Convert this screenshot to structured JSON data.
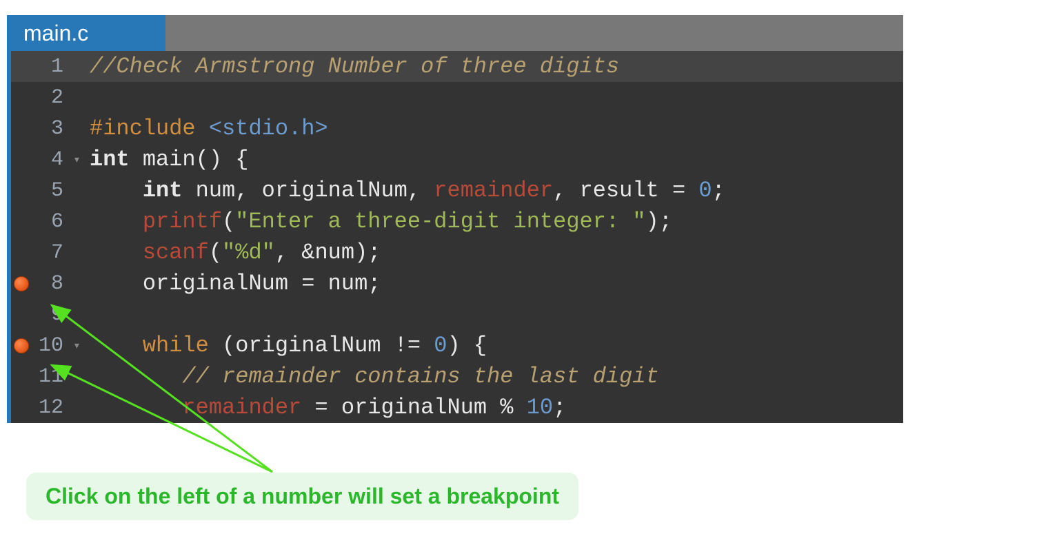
{
  "tab": {
    "filename": "main.c"
  },
  "annotation": {
    "text": "Click on the left of a number will set a breakpoint"
  },
  "lines": {
    "l1": {
      "num": "1"
    },
    "l2": {
      "num": "2"
    },
    "l3": {
      "num": "3"
    },
    "l4": {
      "num": "4"
    },
    "l5": {
      "num": "5"
    },
    "l6": {
      "num": "6"
    },
    "l7": {
      "num": "7"
    },
    "l8": {
      "num": "8"
    },
    "l9": {
      "num": "9"
    },
    "l10": {
      "num": "10"
    },
    "l11": {
      "num": "11"
    },
    "l12": {
      "num": "12"
    }
  },
  "code": {
    "l1_comment": "//Check Armstrong Number of three digits",
    "l3_include": "#include ",
    "l3_path": "<stdio.h>",
    "l4_kw_int": "int",
    "l4_main": " main() {",
    "l5_indent": "    ",
    "l5_kw_int": "int",
    "l5_decl1": " num, originalNum, ",
    "l5_remainder": "remainder",
    "l5_decl2": ", result = ",
    "l5_zero": "0",
    "l5_semi": ";",
    "l6_indent": "    ",
    "l6_printf": "printf",
    "l6_open": "(",
    "l6_str": "\"Enter a three-digit integer: \"",
    "l6_close": ");",
    "l7_indent": "    ",
    "l7_scanf": "scanf",
    "l7_open": "(",
    "l7_fmt": "\"%d\"",
    "l7_mid": ", &num);",
    "l8_indent": "    ",
    "l8_text": "originalNum = num;",
    "l10_indent": "    ",
    "l10_while": "while",
    "l10_cond1": " (originalNum != ",
    "l10_zero": "0",
    "l10_cond2": ") {",
    "l11_indent": "       ",
    "l11_comment": "// remainder contains the last digit",
    "l12_indent": "       ",
    "l12_remainder": "remainder",
    "l12_text1": " = originalNum % ",
    "l12_ten": "10",
    "l12_semi": ";"
  },
  "fold": {
    "open": "▾"
  }
}
